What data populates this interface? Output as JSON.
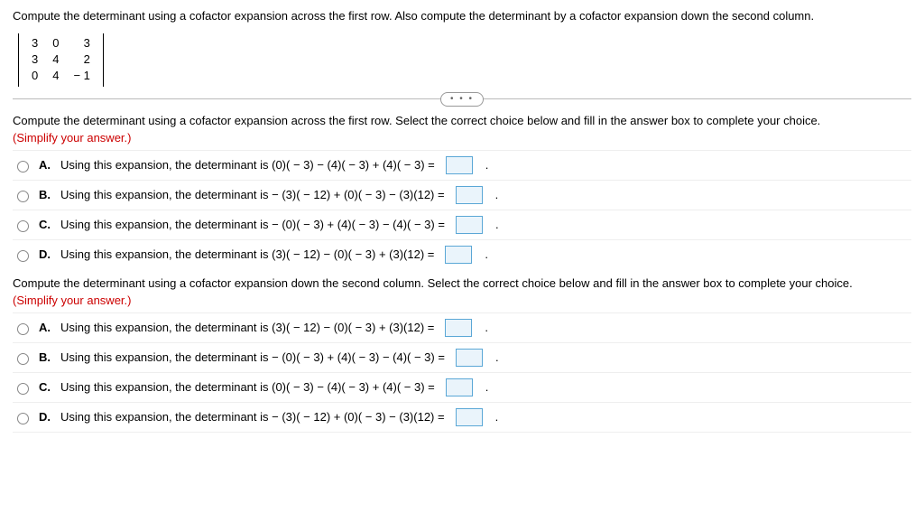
{
  "header": "Compute the determinant using a cofactor expansion across the first row. Also compute the determinant by a cofactor expansion down the second column.",
  "matrix": [
    [
      "3",
      "0",
      "3"
    ],
    [
      "3",
      "4",
      "2"
    ],
    [
      "0",
      "4",
      "− 1"
    ]
  ],
  "more_dots": "• • •",
  "part1": {
    "prompt": "Compute the determinant using a cofactor expansion across the first row. Select the correct choice below and fill in the answer box to complete your choice.",
    "simplify": "(Simplify your answer.)",
    "choices": [
      {
        "letter": "A.",
        "text": "Using this expansion, the determinant is (0)( − 3) − (4)( − 3) + (4)( − 3) ="
      },
      {
        "letter": "B.",
        "text": "Using this expansion, the determinant is  − (3)( − 12) + (0)( − 3) − (3)(12) ="
      },
      {
        "letter": "C.",
        "text": "Using this expansion, the determinant is  − (0)( − 3) + (4)( − 3) − (4)( − 3) ="
      },
      {
        "letter": "D.",
        "text": "Using this expansion, the determinant is (3)( − 12) − (0)( − 3) + (3)(12) ="
      }
    ]
  },
  "part2": {
    "prompt": "Compute the determinant using a cofactor expansion down the second column. Select the correct choice below and fill in the answer box to complete your choice.",
    "simplify": "(Simplify your answer.)",
    "choices": [
      {
        "letter": "A.",
        "text": "Using this expansion, the determinant is (3)( − 12) − (0)( − 3) + (3)(12) ="
      },
      {
        "letter": "B.",
        "text": "Using this expansion, the determinant is  − (0)( − 3) + (4)( − 3) − (4)( − 3) ="
      },
      {
        "letter": "C.",
        "text": "Using this expansion, the determinant is (0)( − 3) − (4)( − 3) + (4)( − 3) ="
      },
      {
        "letter": "D.",
        "text": "Using this expansion, the determinant is  − (3)( − 12) + (0)( − 3) − (3)(12) ="
      }
    ]
  }
}
